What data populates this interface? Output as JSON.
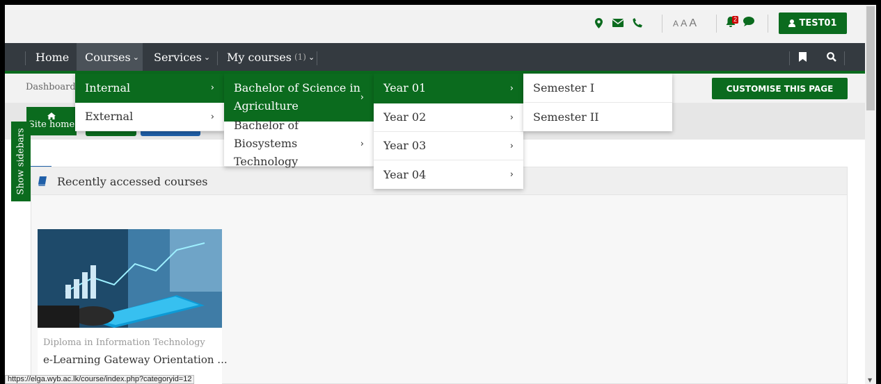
{
  "topbar": {
    "font_sizes": [
      "A",
      "A",
      "A"
    ],
    "notification_count": "2",
    "user_label": "TEST01"
  },
  "nav": {
    "items": [
      {
        "label": "Home"
      },
      {
        "label": "Courses"
      },
      {
        "label": "Services"
      },
      {
        "label": "My courses",
        "count": "(1)"
      }
    ]
  },
  "breadcrumb": {
    "label": "Dashboard"
  },
  "customise_label": "CUSTOMISE THIS PAGE",
  "site_home_label": "Site home",
  "sidebar_toggle_label": "Show sidebars",
  "block": {
    "title": "Recently accessed courses"
  },
  "course": {
    "category": "Diploma in Information Technology",
    "name": "e-Learning Gateway Orientation ..."
  },
  "status_url": "https://elga.wyb.ac.lk/course/index.php?categoryid=12",
  "menus": {
    "level1": [
      "Internal",
      "External"
    ],
    "level2": [
      "Bachelor of Science in Agriculture",
      "Bachelor of Biosystems Technology"
    ],
    "level2_lines": [
      [
        "Bachelor of Science in",
        "Agriculture"
      ],
      [
        "Bachelor of Biosystems",
        "Technology"
      ]
    ],
    "level3": [
      "Year 01",
      "Year 02",
      "Year 03",
      "Year 04"
    ],
    "level4": [
      "Semester I",
      "Semester II"
    ]
  },
  "colors": {
    "brand_green": "#0b6b1e",
    "navbar": "#343a40",
    "accent_blue": "#1f5fa8"
  },
  "icons": {
    "location": "map-marker-icon",
    "mail": "envelope-icon",
    "phone": "phone-icon",
    "bell": "bell-icon",
    "chat": "comment-icon",
    "user": "user-icon",
    "bookmark": "bookmark-icon",
    "search": "search-icon",
    "home": "home-icon",
    "book": "book-icon"
  }
}
